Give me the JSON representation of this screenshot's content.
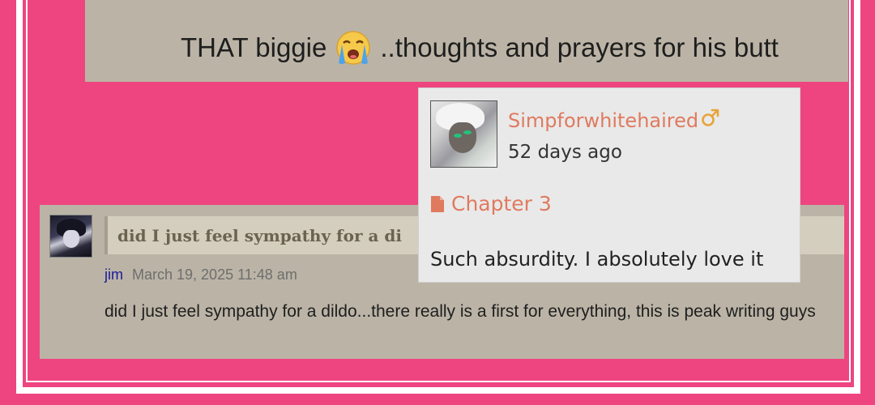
{
  "top_comment": {
    "text_before_emoji": "THAT biggie",
    "emoji": "loudly-crying-face",
    "text_after_emoji": "..thoughts and prayers for his butt"
  },
  "bottom_comment": {
    "quote_text": "did I just feel sympathy for a di",
    "author": "jim",
    "date": "March 19, 2025 11:48 am",
    "body": "did I just feel sympathy for a dildo...there really is a first for everything, this is peak writing guys"
  },
  "tooltip_card": {
    "username": "Simpforwhitehaired",
    "gender_icon": "male-icon",
    "time_ago": "52 days ago",
    "chapter": "Chapter 3",
    "comment": "Such absurdity. I absolutely love it"
  },
  "colors": {
    "page_background": "#ee4580",
    "comment_background": "#bbb4a6",
    "quote_background": "#d4cebf",
    "card_background": "#e9e9e9",
    "accent_orange": "#e07a5f",
    "author_link": "#1a1a9a"
  }
}
